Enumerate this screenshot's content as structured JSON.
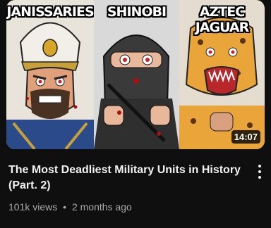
{
  "video": {
    "thumbnail_labels": [
      "JANISSARIES",
      "SHINOBI",
      "AZTEC JAGUAR"
    ],
    "duration": "14:07",
    "title": "The Most Deadliest Military Units in History (Part. 2)",
    "views": "101k views",
    "separator": "•",
    "age": "2 months ago"
  },
  "icons": {
    "more": "vertical-ellipsis-icon"
  }
}
